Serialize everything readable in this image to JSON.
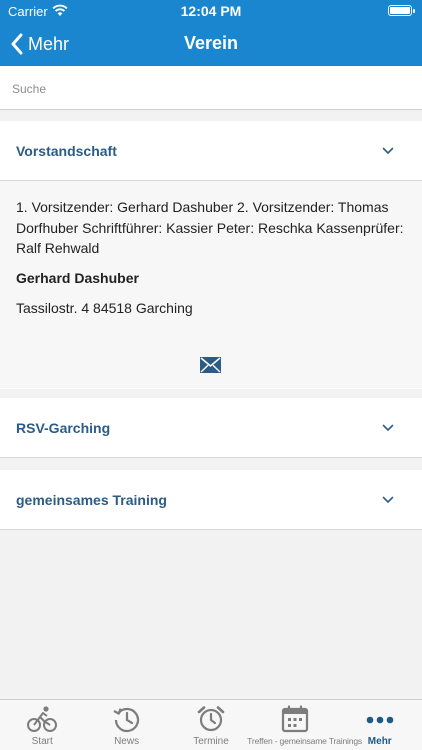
{
  "status_bar": {
    "carrier": "Carrier",
    "time": "12:04 PM"
  },
  "nav": {
    "back_label": "Mehr",
    "title": "Verein"
  },
  "search": {
    "placeholder": "Suche",
    "value": ""
  },
  "sections": [
    {
      "title": "Vorstandschaft",
      "expanded": true,
      "description": "1. Vorsitzender: Gerhard Dashuber 2. Vorsitzender: Thomas Dorfhuber Schriftführer: Kassier Peter: Reschka Kassenprüfer: Ralf Rehwald",
      "contact_name": "Gerhard Dashuber",
      "address": "Tassilostr. 4 84518 Garching",
      "icon": "mail-icon"
    },
    {
      "title": "RSV-Garching",
      "expanded": false
    },
    {
      "title": "gemeinsames Training",
      "expanded": false
    }
  ],
  "tabs": [
    {
      "label": "Start",
      "icon": "bicycle-icon",
      "active": false
    },
    {
      "label": "News",
      "icon": "history-icon",
      "active": false
    },
    {
      "label": "Termine",
      "icon": "alarm-clock-icon",
      "active": false
    },
    {
      "label": "Treffen - gemeinsame Trainings",
      "icon": "calendar-icon",
      "active": false
    },
    {
      "label": "Mehr",
      "icon": "more-dots-icon",
      "active": true
    }
  ],
  "colors": {
    "header": "#1a86cf",
    "section_title": "#2b5c88",
    "active_tab": "#1d5a86",
    "inactive_tab": "#7d7d7d"
  }
}
